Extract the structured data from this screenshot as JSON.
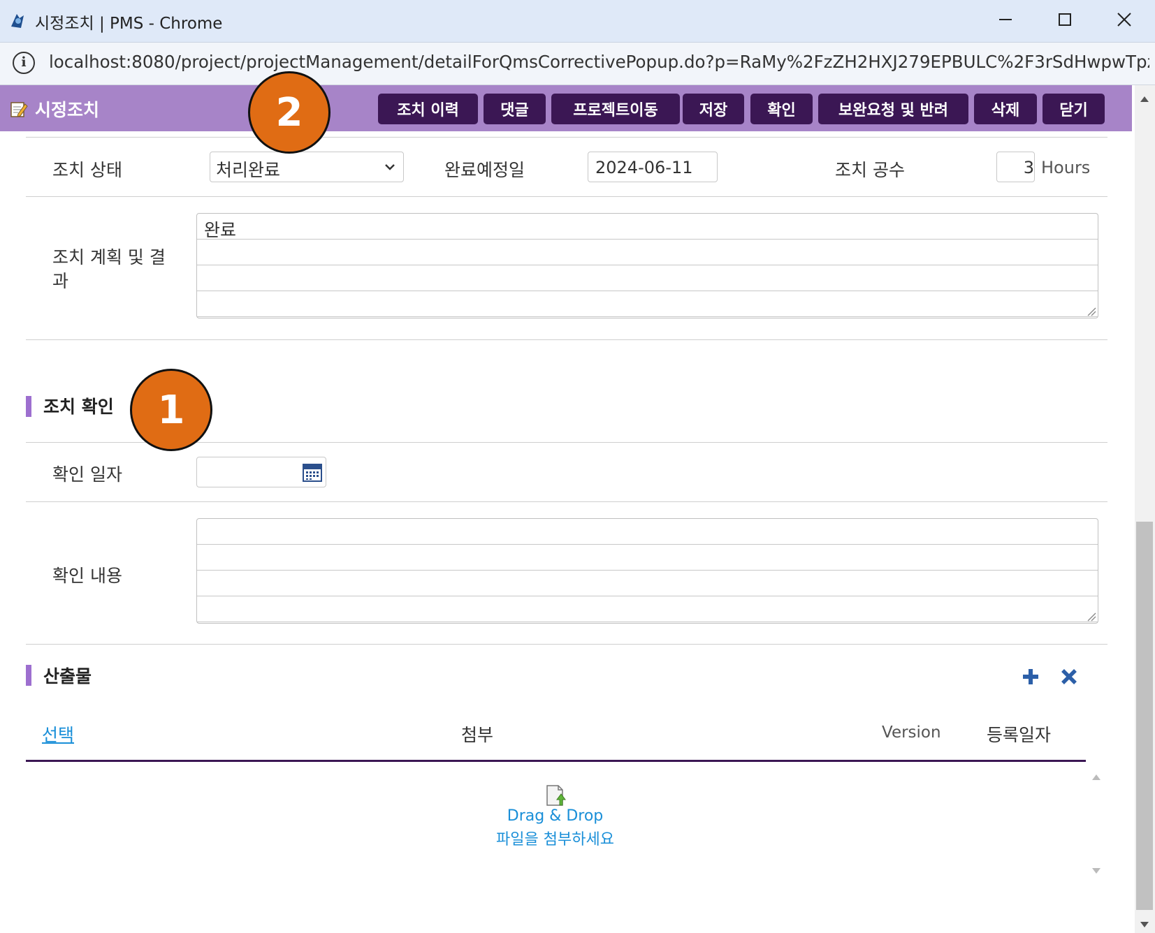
{
  "window": {
    "title": "시정조치 | PMS - Chrome",
    "url": "localhost:8080/project/projectManagement/detailForQmsCorrectivePopup.do?p=RaMy%2FzZH2HXJ279EPBULC%2F3rSdHwpwTpz..."
  },
  "popup": {
    "title": "시정조치",
    "buttons": [
      "조치 이력",
      "댓글",
      "프로젝트이동",
      "저장",
      "확인",
      "보완요청 및 반려",
      "삭제",
      "닫기"
    ]
  },
  "form": {
    "status_label": "조치 상태",
    "status_value": "처리완료",
    "due_label": "완료예정일",
    "due_value": "2024-06-11",
    "hours_label": "조치 공수",
    "hours_value": "3",
    "hours_unit": "Hours",
    "plan_label_line1": "조치 계획 및 결",
    "plan_label_line2": "과",
    "plan_text": "완료"
  },
  "confirm": {
    "section_title": "조치 확인",
    "date_label": "확인 일자",
    "date_value": "",
    "content_label": "확인 내용",
    "content_value": ""
  },
  "outputs": {
    "section_title": "산출물",
    "columns": [
      "선택",
      "첨부",
      "Version",
      "등록일자"
    ],
    "drop_line1": "Drag & Drop",
    "drop_line2": "파일을 첨부하세요"
  },
  "annotations": [
    "1",
    "2"
  ],
  "colors": {
    "header_bg": "#a784c8",
    "button_bg": "#3b1754",
    "badge_bg": "#e06c14",
    "link_blue": "#1a8fd8"
  },
  "icons": [
    "app-icon",
    "info-icon",
    "minimize-icon",
    "maximize-icon",
    "close-icon",
    "edit-icon",
    "dropdown-chevron-icon",
    "calendar-icon",
    "add-icon",
    "delete-icon",
    "file-upload-icon",
    "scroll-up-icon",
    "scroll-down-icon"
  ]
}
